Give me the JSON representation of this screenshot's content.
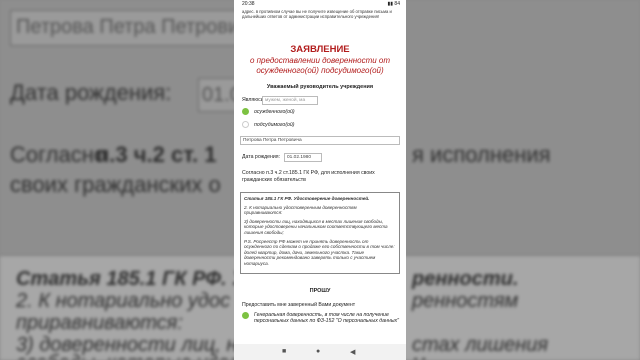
{
  "background": {
    "name_field": "Петрова Петра Петрови",
    "birth_label": "Дата рождения:",
    "birth_value": "01.0",
    "line1a": "Согласно ",
    "line1b": "п.3 ч.2 ст. 1",
    "line1c": "я исполнения",
    "line2": "своих гражданских о",
    "article_a": "Статья 185.1 ГК РФ. У",
    "article_b": "ренности.",
    "p2a": "2. К нотариально удос",
    "p2b": "ренностям",
    "p3": "приравниваются:",
    "p4a": "3) доверенности лиц, на",
    "p4b": "стах лишения",
    "p5a": "свободы, которые удос",
    "p5b": "м"
  },
  "status": {
    "time": "20:38",
    "icons": "▮▮ 84"
  },
  "notice": "адрес. в противном случае вы не получите извещение об отправке письма и дальнейших ответов от администрации исправительного учреждения!",
  "header": {
    "title": "ЗАЯВЛЕНИЕ",
    "subtitle": "о предоставлении доверенности от осужденного(ой) подсудимого(ой)"
  },
  "greeting": "Уважаемый руководитель учреждения",
  "form": {
    "status_label": "Являюсь",
    "status_placeholder": "мужем, женой, ма",
    "option1": "осужденного(ой)",
    "option2": "подсудимого(ой)",
    "name_value": "Петрова Петра Петровича",
    "birth_label": "Дата рождения:",
    "birth_value": "01.02.1980",
    "basis_text": "Согласно п.3 ч.2 ст.185.1 ГК РФ, для исполнения своих гражданских обязательств"
  },
  "law": {
    "title": "Статья 185.1 ГК РФ. Удостоверение доверенностей.",
    "p1": "2. К нотариально удостоверенным доверенностям приравниваются:",
    "p2": "3) доверенности лиц, находящихся в местах лишения свободы, которые удостоверены начальником соответствующего места лишения свободы;",
    "p3": "P.S. Росреестр РФ может не принять доверенность от осужденного по сделкам о продаже его собственности в том числе: долей квартир, дома, дачи, земельного участка. Такие доверенности рекомендовано заверять только с участием нотариуса."
  },
  "request": {
    "heading": "ПРОШУ",
    "text": "Предоставить мне заверенный Вами документ",
    "option": "Генеральная доверенность, в том числе на получение персональных данных по ФЗ-152 \"О персональных данных\""
  },
  "nav": {
    "menu": "■",
    "home": "●",
    "back": "◀"
  },
  "colors": {
    "title_red": "#b21c1c",
    "radio_green": "#7dc242"
  }
}
